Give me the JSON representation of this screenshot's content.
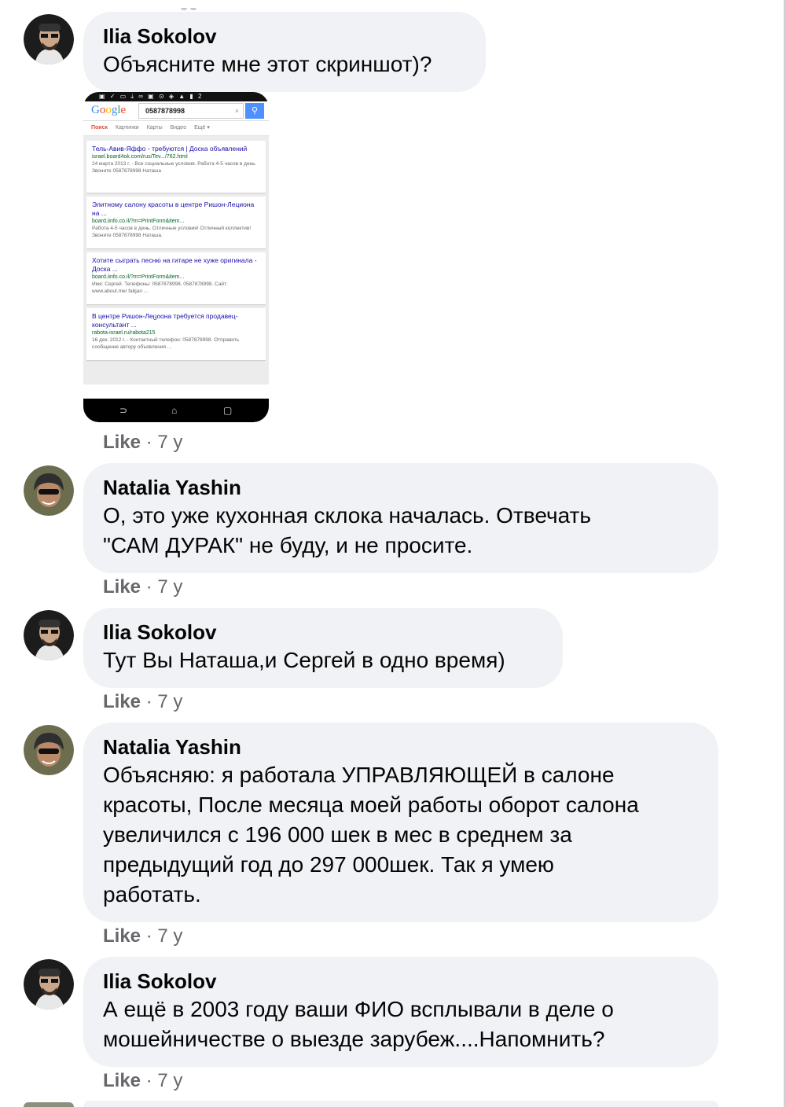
{
  "comments": [
    {
      "author": "Ilia Sokolov",
      "text_lines": [
        "Объясните мне этот скриншот)?"
      ],
      "like": "Like",
      "time": "7 y",
      "avatar": "avatar-ilia"
    },
    {
      "author": "Natalia Yashin",
      "text_lines": [
        "О, это уже кухонная склока началась. Отвечать",
        "\"САМ ДУРАК\" не буду, и не просите."
      ],
      "like": "Like",
      "time": "7 y",
      "avatar": "avatar-natalia"
    },
    {
      "author": "Ilia Sokolov",
      "text_lines": [
        "Тут Вы Наташа,и Сергей в одно время)"
      ],
      "like": "Like",
      "time": "7 y",
      "avatar": "avatar-ilia"
    },
    {
      "author": "Natalia Yashin",
      "text_lines": [
        "Объясняю: я работала УПРАВЛЯЮЩЕЙ в салоне",
        "красоты, После месяца моей работы оборот салона",
        "увеличился с 196 000 шек в мес в среднем за",
        "предыдущий год до 297 000шек. Так я умею",
        "работать."
      ],
      "like": "Like",
      "time": "7 y",
      "avatar": "avatar-natalia"
    },
    {
      "author": "Ilia Sokolov",
      "text_lines": [
        "А ещё в 2003 году ваши ФИО всплывали в деле о",
        "мошейничестве о выезде зарубеж....Напомнить?"
      ],
      "like": "Like",
      "time": "7 y",
      "avatar": "avatar-ilia"
    }
  ],
  "separator": " · ",
  "attachment": {
    "status_bar": "▣ ✓ ▭ ⤓ ∞ ▣   ⊙ ◈ ▲ ▮ 2",
    "logo": [
      "G",
      "o",
      "o",
      "g",
      "l",
      "e"
    ],
    "query": "0587878998",
    "clear": "×",
    "search_icon": "⚲",
    "tabs": [
      "Поиск",
      "Картинки",
      "Карты",
      "Видео",
      "Ещё ▾"
    ],
    "results": [
      {
        "title": "Тель-Авив-Яффо - требуются | Доска объявлений",
        "url": "israel.board4ok.com/rus/Tev.../762.html",
        "snippet": "24 марта 2013 г. - Все социальные условия. Работа 4-5 часов в день. Звоните 0587878998 Наташа"
      },
      {
        "title": "Элитному салону красоты в центре Ришон-Лециона на ...",
        "url": "board.iinfo.co.il/?m=PrintForm&item...",
        "snippet": "Работа 4-5 часов в день. Отличные условия! Отличный коллектив! Звоните 0587878998 Наташа."
      },
      {
        "title": "Хотите сыграть песню на гитаре не хуже оригинала - Доска ...",
        "url": "board.iinfo.co.il/?m=PrintForm&item...",
        "snippet": "Имя: Сергей. Телефоны: 0587878998, 0587878998. Сайт: www.about.me/ fabjan ..."
      },
      {
        "title": "В центре Ришон-Леციона требуется продавец- консультант ...",
        "url": "rabota-israel.ru/rabota215",
        "snippet": "16 дек. 2012 г. - Контактный телефон: 0587878998. Отправить сообщение автору объявления ..."
      }
    ],
    "nav": [
      "⊃",
      "⌂",
      "▢"
    ]
  }
}
